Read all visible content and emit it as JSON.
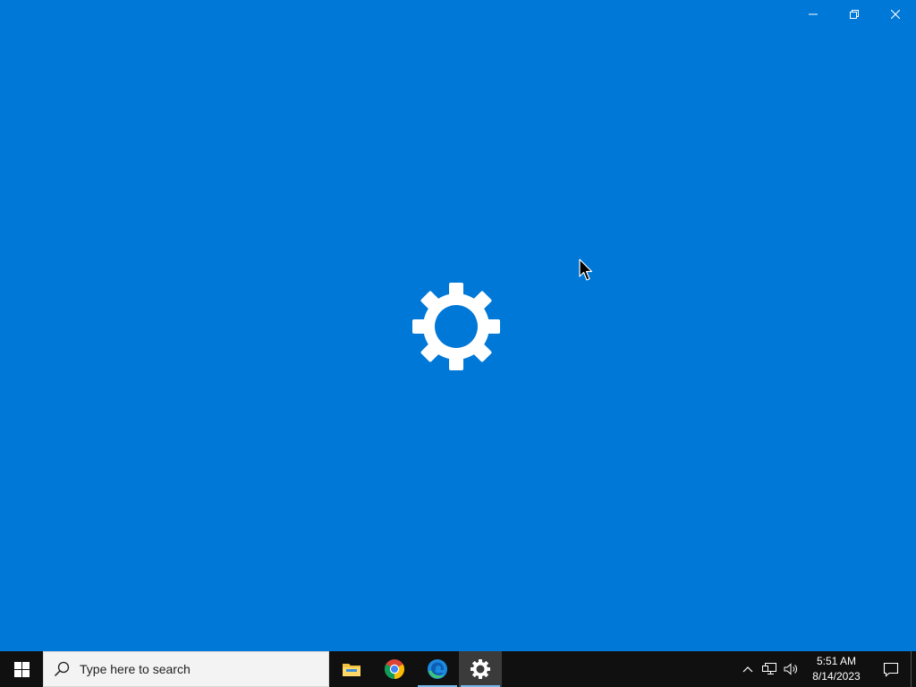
{
  "window": {
    "app_icon": "gear-icon",
    "background_color": "#0078d7",
    "caption_buttons": [
      "minimize-icon",
      "restore-icon",
      "close-icon"
    ]
  },
  "taskbar": {
    "start_icon": "windows-logo-icon",
    "search": {
      "placeholder": "Type here to search",
      "icon": "search-icon"
    },
    "pinned_apps": [
      {
        "name": "File Explorer",
        "icon": "folder-icon",
        "running": false
      },
      {
        "name": "Google Chrome",
        "icon": "chrome-icon",
        "running": false
      },
      {
        "name": "Microsoft Edge",
        "icon": "edge-icon",
        "running": true
      },
      {
        "name": "Settings",
        "icon": "gear-icon",
        "running": true,
        "active": true
      }
    ],
    "tray": {
      "icons": [
        "chevron-up-icon",
        "network-icon",
        "volume-icon"
      ],
      "time": "5:51 AM",
      "date": "8/14/2023",
      "notification_icon": "action-center-icon"
    }
  }
}
